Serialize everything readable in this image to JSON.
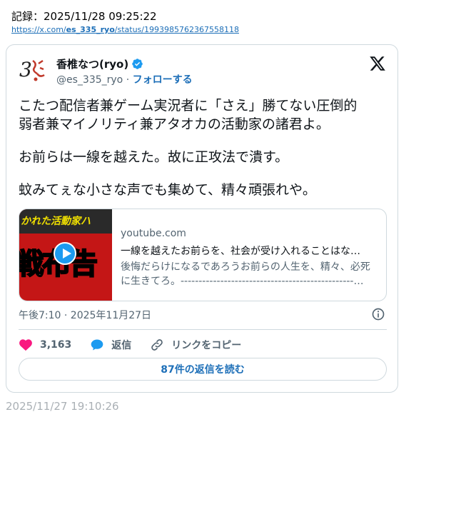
{
  "record": {
    "label": "記録：2025/11/28 09:25:22",
    "url_prefix": "https://x.com/",
    "url_handle": "es_335_ryo",
    "url_suffix": "/status/1993985762367558118"
  },
  "tweet": {
    "author_name": "香椎なつ(ryo)",
    "handle": "@es_335_ryo",
    "separator": " · ",
    "follow_label": "フォローする",
    "text_lines": [
      "こたつ配信者兼ゲーム実況者に「さえ」勝てない圧倒的",
      "弱者兼マイノリティ兼アタオカの活動家の諸君よ。",
      "",
      "お前らは一線を越えた。故に正攻法で潰す。",
      "",
      "蚊みてぇな小さな声でも集めて、精々頑張れや。"
    ],
    "link_card": {
      "thumb_top_text": "かれた活動家ハ",
      "thumb_big_text": "戦布告",
      "domain": "youtube.com",
      "title": "一線を越えたお前らを、社会が受け入れることはな…",
      "description": "後悔だらけになるであろうお前らの人生を、精々、必死に生きてろ。------------------------------------------------…"
    },
    "timestamp": "午後7:10 · 2025年11月27日",
    "likes": "3,163",
    "reply_label": "返信",
    "copy_link_label": "リンクをコピー",
    "read_replies_label": "87件の返信を読む"
  },
  "footer_time": "2025/11/27 19:10:26",
  "colors": {
    "accent": "#1d9bf0",
    "link": "#1d6fb8",
    "like": "#f91880",
    "muted": "#536471"
  }
}
